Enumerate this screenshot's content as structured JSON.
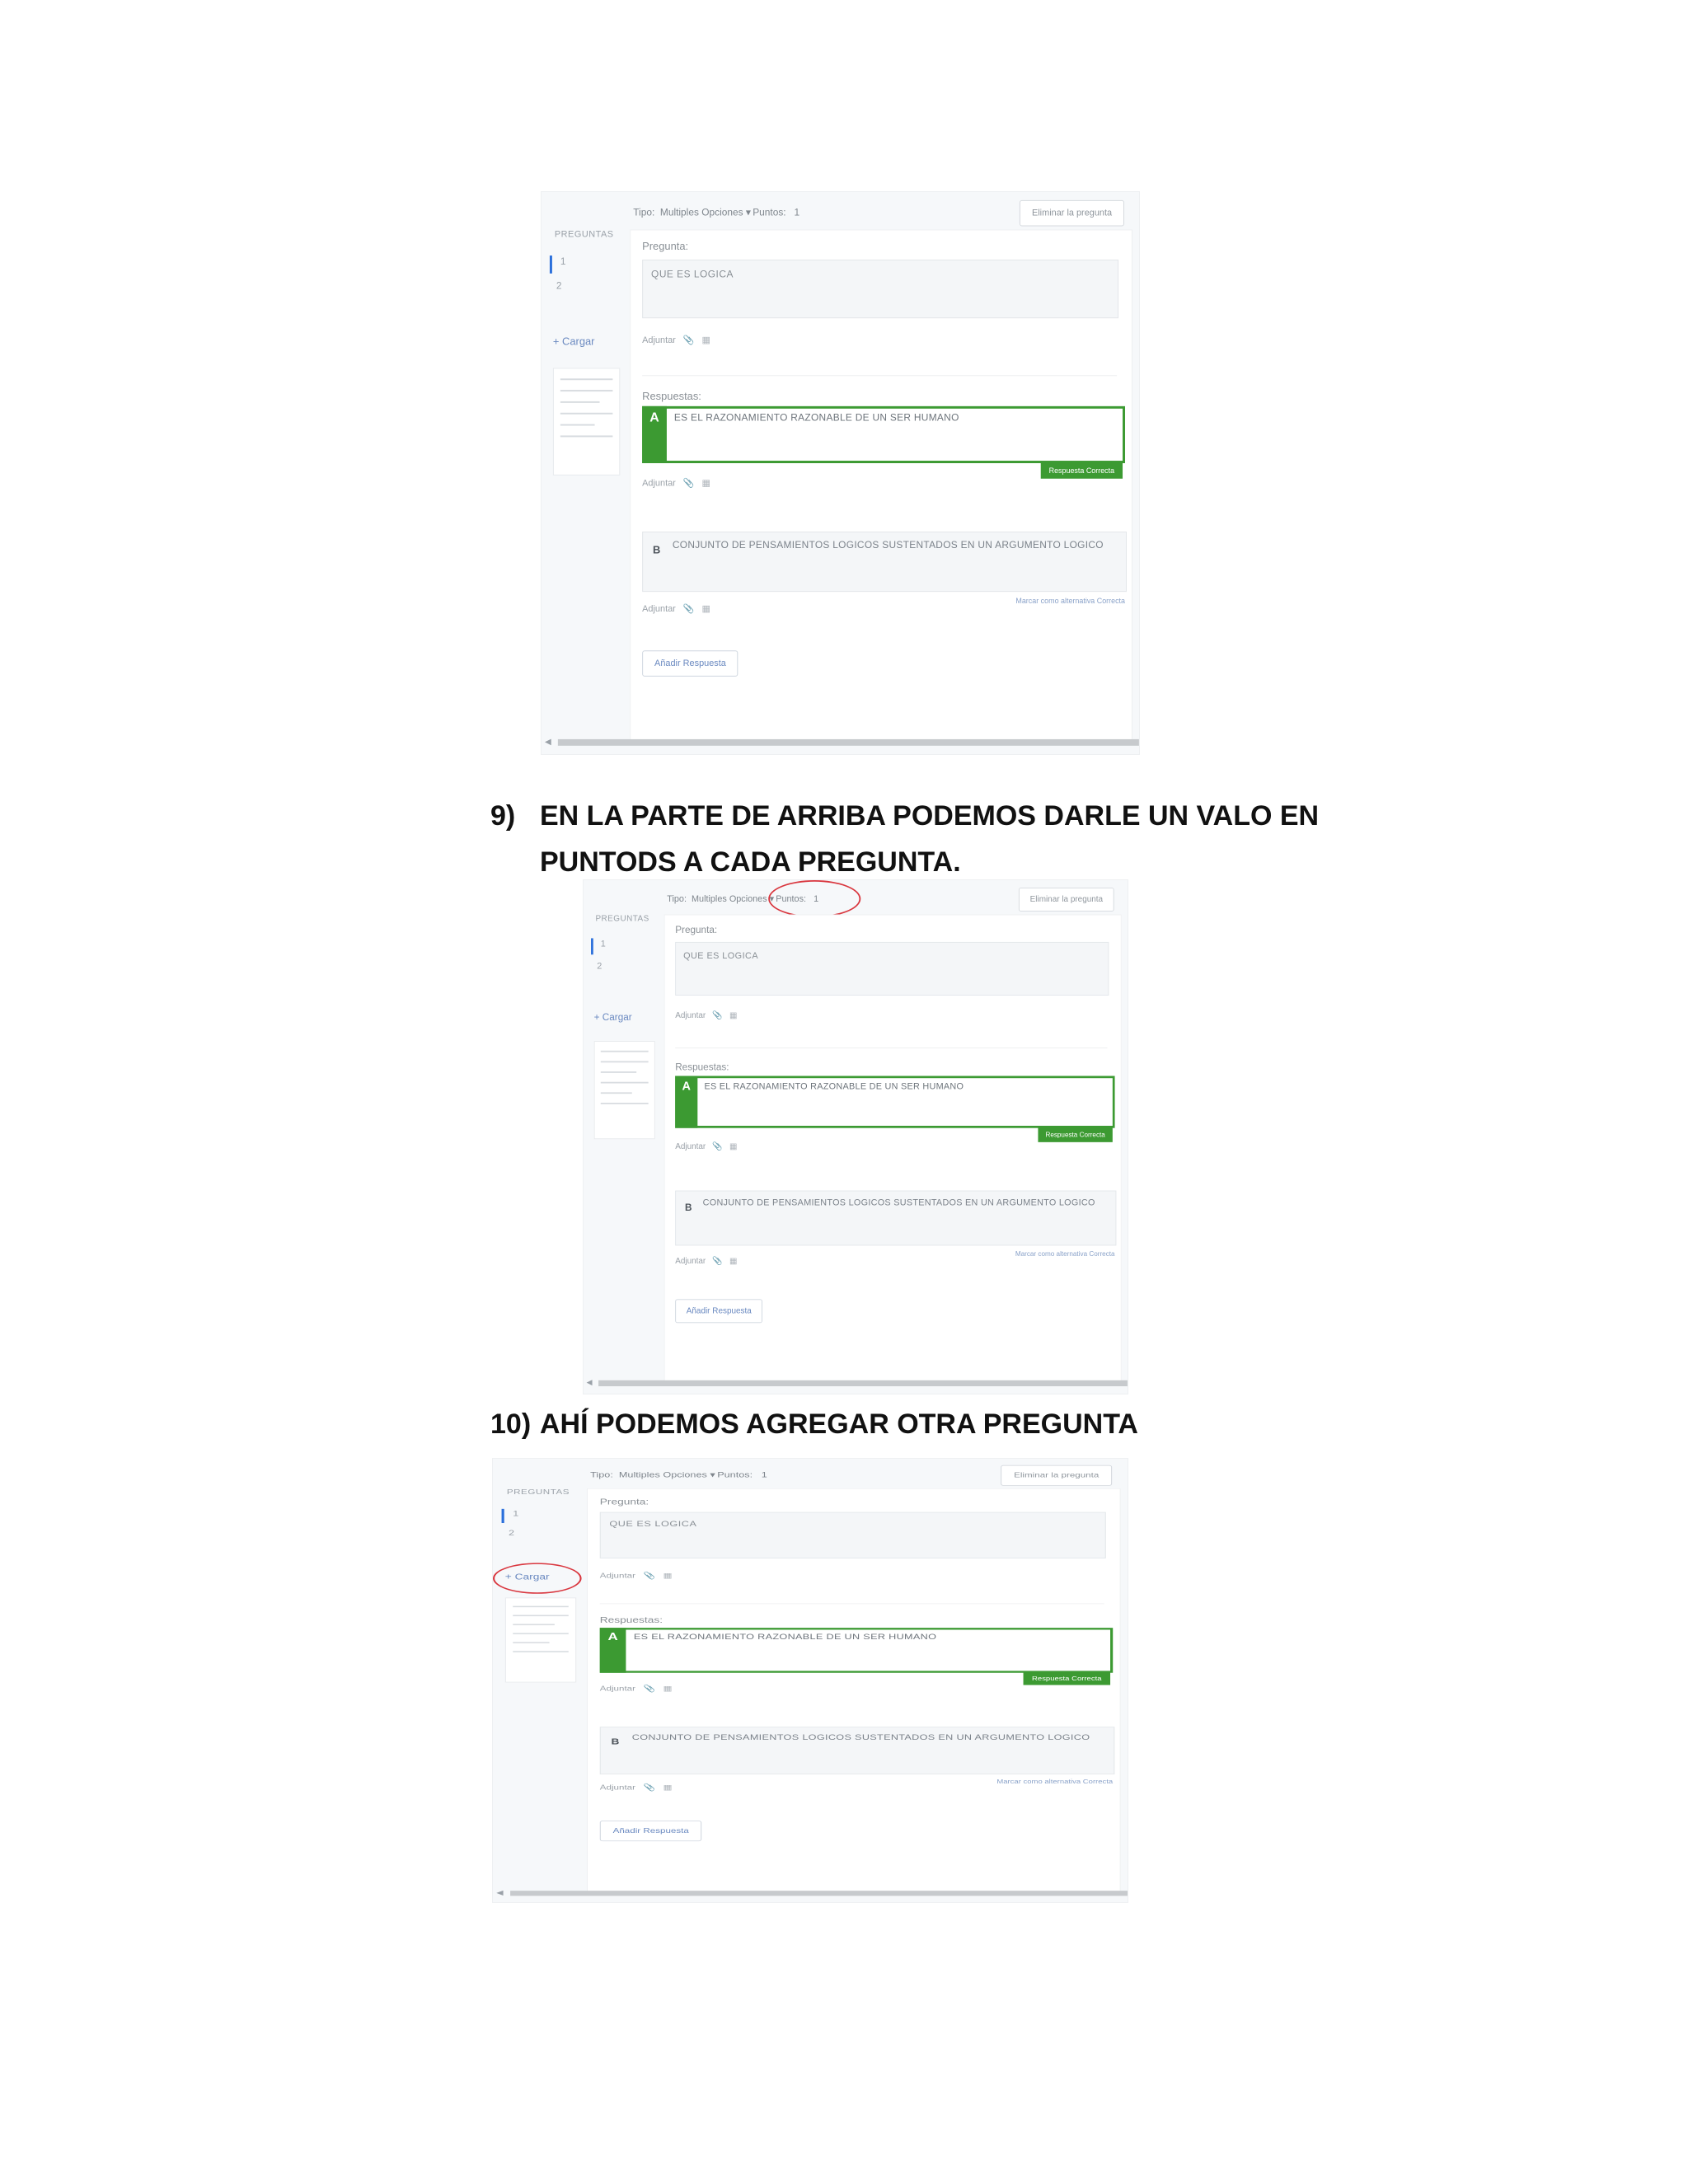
{
  "steps": [
    {
      "number": "9)",
      "text": "EN LA PARTE DE ARRIBA PODEMOS DARLE UN VALO EN PUNTODS A CADA PREGUNTA."
    },
    {
      "number": "10)",
      "text": "AHÍ PODEMOS AGREGAR OTRA PREGUNTA"
    }
  ],
  "editor": {
    "type_label": "Tipo:",
    "type_value": "Multiples Opciones",
    "points_label": "Puntos:",
    "points_value": "1",
    "delete_button": "Eliminar la pregunta",
    "sidebar_title": "PREGUNTAS",
    "sidebar_items": [
      "1",
      "2"
    ],
    "add_label": "+ Cargar",
    "question_label": "Pregunta:",
    "question_text": "QUE ES LOGICA",
    "attach_label": "Adjuntar",
    "answers_label": "Respuestas:",
    "answer_a_letter": "A",
    "answer_a_text": "ES EL RAZONAMIENTO RAZONABLE DE UN SER HUMANO",
    "correct_tag": "Respuesta Correcta",
    "answer_b_letter": "B",
    "answer_b_text": "CONJUNTO DE PENSAMIENTOS LOGICOS SUSTENTADOS EN UN ARGUMENTO LOGICO",
    "mark_correct": "Marcar como alternativa Correcta",
    "add_answer": "Añadir Respuesta"
  },
  "colors": {
    "correct_green": "#3c9a32",
    "annotation_red": "#d9363e",
    "link_blue": "#6a89c0"
  },
  "icons": [
    "paperclip-icon",
    "image-icon",
    "plus-icon",
    "chevron-down-icon"
  ]
}
